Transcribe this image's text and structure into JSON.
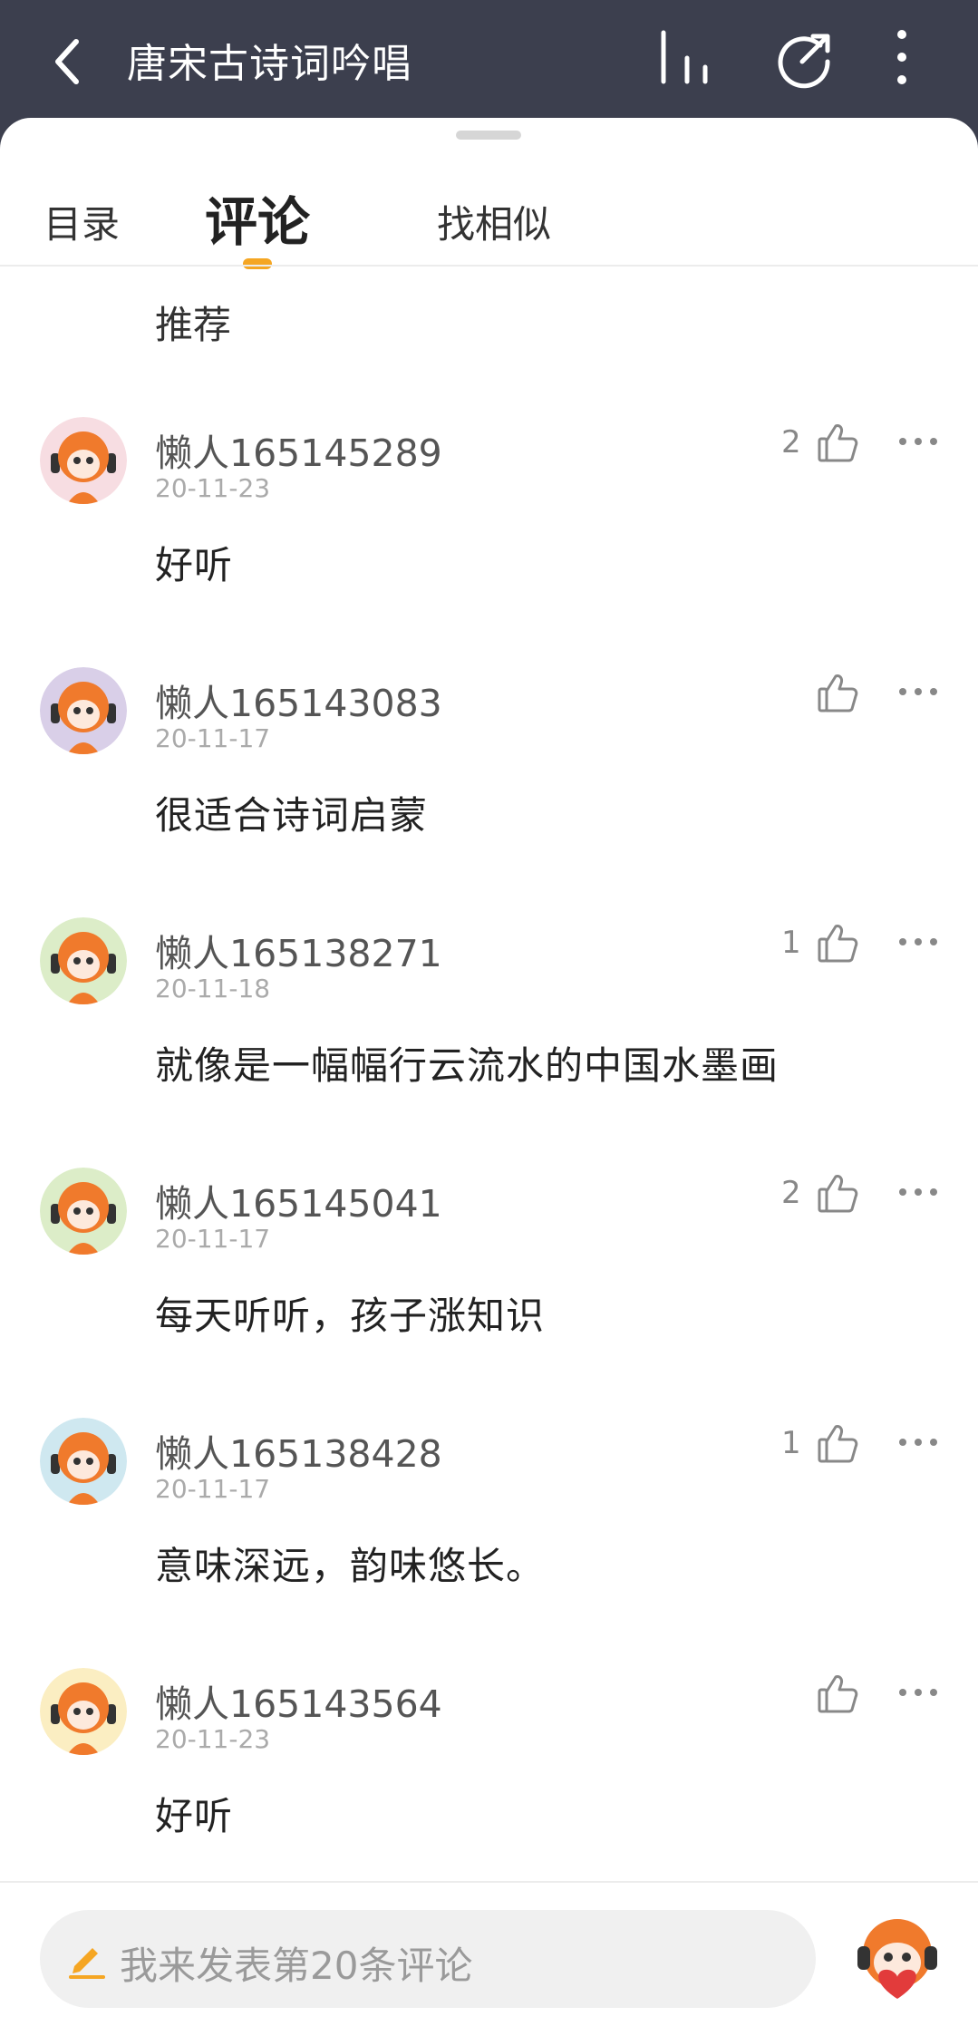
{
  "header": {
    "title": "唐宋古诗词吟唱",
    "icons": [
      "back-arrow-icon",
      "bars-icon",
      "share-icon",
      "more-vertical-icon"
    ]
  },
  "tabs": [
    {
      "label": "目录",
      "active": false
    },
    {
      "label": "评论",
      "active": true
    },
    {
      "label": "找相似",
      "active": false
    }
  ],
  "colors": {
    "header_bg": "#3c3f4e",
    "accent": "#f5a623",
    "avatar_orange": "#f07a2c"
  },
  "previous_comment": {
    "text": "推荐"
  },
  "comments": [
    {
      "username": "懒人165145289",
      "date": "20-11-23",
      "likes": "2",
      "text": "好听",
      "avatar_bg": "#f7dde2"
    },
    {
      "username": "懒人165143083",
      "date": "20-11-17",
      "likes": "",
      "text": "很适合诗词启蒙",
      "avatar_bg": "#d9cfe8"
    },
    {
      "username": "懒人165138271",
      "date": "20-11-18",
      "likes": "1",
      "text": "就像是一幅幅行云流水的中国水墨画",
      "avatar_bg": "#dcedc8"
    },
    {
      "username": "懒人165145041",
      "date": "20-11-17",
      "likes": "2",
      "text": "每天听听，孩子涨知识",
      "avatar_bg": "#dcedc8"
    },
    {
      "username": "懒人165138428",
      "date": "20-11-17",
      "likes": "1",
      "text": "意味深远，韵味悠长。",
      "avatar_bg": "#cfe8f0"
    },
    {
      "username": "懒人165143564",
      "date": "20-11-23",
      "likes": "",
      "text": "好听",
      "avatar_bg": "#fbeec2"
    }
  ],
  "input": {
    "placeholder": "我来发表第20条评论"
  }
}
